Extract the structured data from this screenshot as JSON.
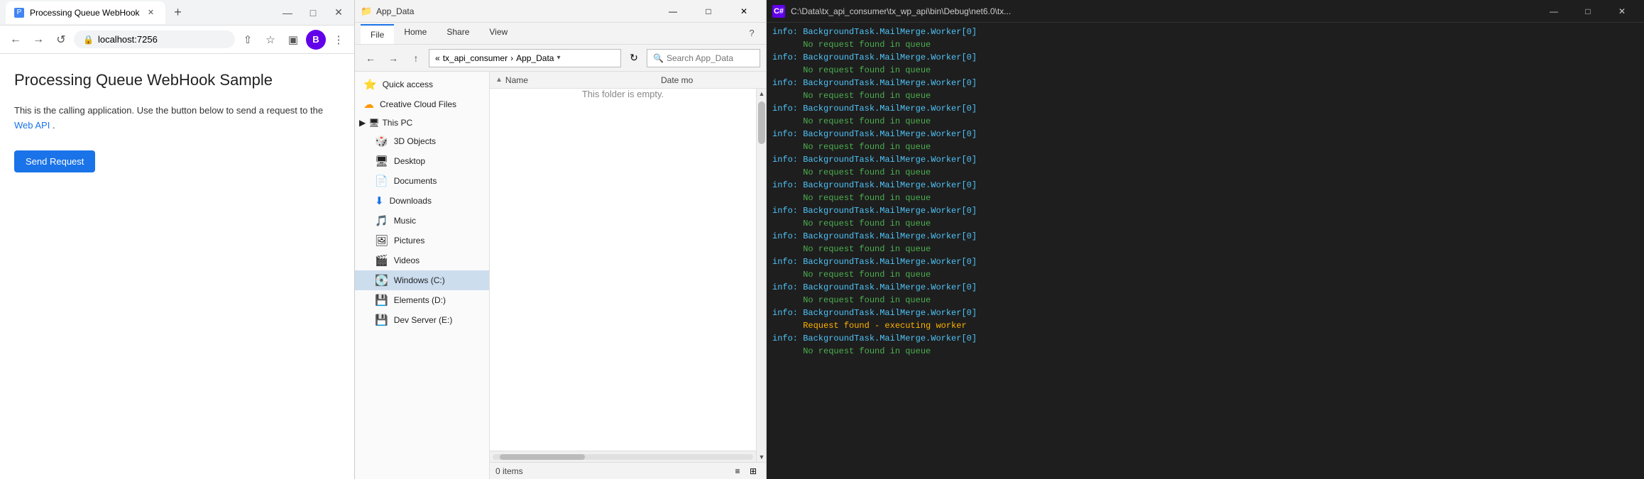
{
  "browser": {
    "tab_title": "Processing Queue WebHook",
    "tab_favicon": "P",
    "new_tab_icon": "+",
    "controls": {
      "minimize": "—",
      "maximize": "□",
      "close": "✕"
    },
    "nav": {
      "back": "←",
      "forward": "→",
      "reload": "↺",
      "address": "localhost:7256"
    },
    "toolbar_icons": {
      "share": "⇧",
      "star": "☆",
      "sidebar": "▣",
      "profile": "B",
      "more": "⋮"
    },
    "page": {
      "title": "Processing Queue WebHook Sample",
      "description_start": "This is the calling application. Use the button below to send a request to the",
      "description_link": "Web API",
      "description_end": ".",
      "send_button": "Send Request"
    }
  },
  "explorer": {
    "window_icon": "📁",
    "title": "App_Data",
    "controls": {
      "minimize": "—",
      "maximize": "□",
      "close": "✕"
    },
    "ribbon_tabs": [
      "File",
      "Home",
      "Share",
      "View"
    ],
    "active_tab": "File",
    "help_icon": "?",
    "nav": {
      "back": "←",
      "forward": "→",
      "up": "↑",
      "breadcrumb": [
        "tx_api_consumer",
        "App_Data"
      ],
      "chevron": "▾",
      "refresh": "↻"
    },
    "search_placeholder": "Search App_Data",
    "sidebar_items": [
      {
        "icon": "⭐",
        "label": "Quick access"
      },
      {
        "icon": "🌟",
        "label": "Creative Cloud Files"
      },
      {
        "icon": "🖥",
        "label": "This PC",
        "expandable": true
      },
      {
        "icon": "🎲",
        "label": "3D Objects"
      },
      {
        "icon": "🖥",
        "label": "Desktop"
      },
      {
        "icon": "📄",
        "label": "Documents"
      },
      {
        "icon": "⬇",
        "label": "Downloads"
      },
      {
        "icon": "🎵",
        "label": "Music"
      },
      {
        "icon": "🖼",
        "label": "Pictures"
      },
      {
        "icon": "🎬",
        "label": "Videos"
      },
      {
        "icon": "💽",
        "label": "Windows (C:)"
      },
      {
        "icon": "💾",
        "label": "Elements (D:)"
      },
      {
        "icon": "💾",
        "label": "Dev Server (E:)"
      }
    ],
    "columns": {
      "name": "Name",
      "date": "Date mo",
      "toggle": "^"
    },
    "empty_message": "This folder is empty.",
    "status": {
      "items": "0 items"
    },
    "scroll": {
      "up": "▲",
      "down": "▼"
    }
  },
  "terminal": {
    "icon": "C#",
    "title": "C:\\Data\\tx_api_consumer\\tx_wp_api\\bin\\Debug\\net6.0\\tx...",
    "controls": {
      "minimize": "—",
      "maximize": "□",
      "close": "✕"
    },
    "logs": [
      "info: BackgroundTask.MailMerge.Worker[0]",
      "      No request found in queue",
      "info: BackgroundTask.MailMerge.Worker[0]",
      "      No request found in queue",
      "info: BackgroundTask.MailMerge.Worker[0]",
      "      No request found in queue",
      "info: BackgroundTask.MailMerge.Worker[0]",
      "      No request found in queue",
      "info: BackgroundTask.MailMerge.Worker[0]",
      "      No request found in queue",
      "info: BackgroundTask.MailMerge.Worker[0]",
      "      No request found in queue",
      "info: BackgroundTask.MailMerge.Worker[0]",
      "      No request found in queue",
      "info: BackgroundTask.MailMerge.Worker[0]",
      "      No request found in queue",
      "info: BackgroundTask.MailMerge.Worker[0]",
      "      No request found in queue",
      "info: BackgroundTask.MailMerge.Worker[0]",
      "      No request found in queue",
      "info: BackgroundTask.MailMerge.Worker[0]",
      "      No request found in queue",
      "info: BackgroundTask.MailMerge.Worker[0]",
      "      Request found - executing worker",
      "info: BackgroundTask.MailMerge.Worker[0]",
      "      No request found in queue"
    ]
  }
}
